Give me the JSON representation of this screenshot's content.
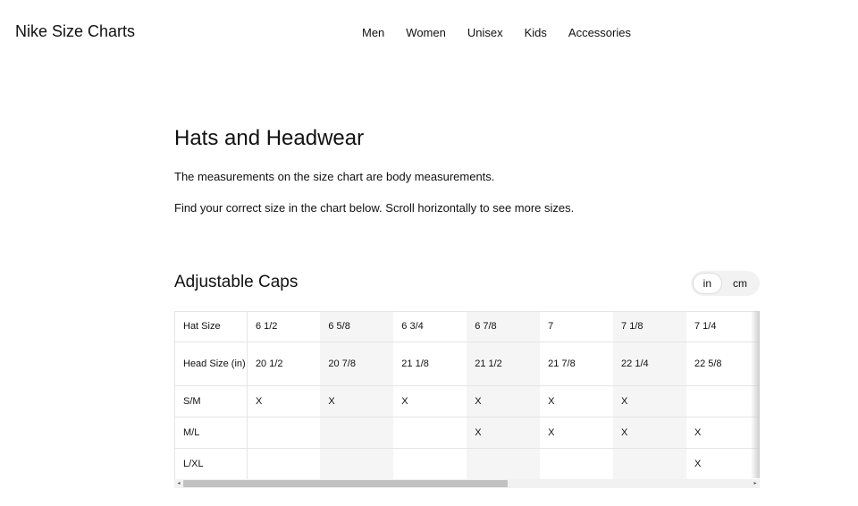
{
  "header": {
    "brand": "Nike Size Charts",
    "nav": [
      "Men",
      "Women",
      "Unisex",
      "Kids",
      "Accessories"
    ]
  },
  "main": {
    "title": "Hats and Headwear",
    "intro1": "The measurements on the size chart are body measurements.",
    "intro2": "Find your correct size in the chart below. Scroll horizontally to see more sizes."
  },
  "section": {
    "title": "Adjustable Caps",
    "units": [
      "in",
      "cm"
    ],
    "active_unit": "in"
  },
  "table": {
    "rows": [
      {
        "label": "Hat Size",
        "cells": [
          "6 1/2",
          "6 5/8",
          "6 3/4",
          "6 7/8",
          "7",
          "7 1/8",
          "7 1/4"
        ]
      },
      {
        "label": "Head Size (in)",
        "cells": [
          "20 1/2",
          "20 7/8",
          "21 1/8",
          "21 1/2",
          "21 7/8",
          "22 1/4",
          "22 5/8"
        ]
      },
      {
        "label": "S/M",
        "cells": [
          "X",
          "X",
          "X",
          "X",
          "X",
          "X",
          ""
        ]
      },
      {
        "label": "M/L",
        "cells": [
          "",
          "",
          "",
          "X",
          "X",
          "X",
          "X"
        ]
      },
      {
        "label": "L/XL",
        "cells": [
          "",
          "",
          "",
          "",
          "",
          "",
          "X"
        ]
      }
    ]
  },
  "scrollbar": {
    "left_arrow": "◂",
    "right_arrow": "▸"
  }
}
